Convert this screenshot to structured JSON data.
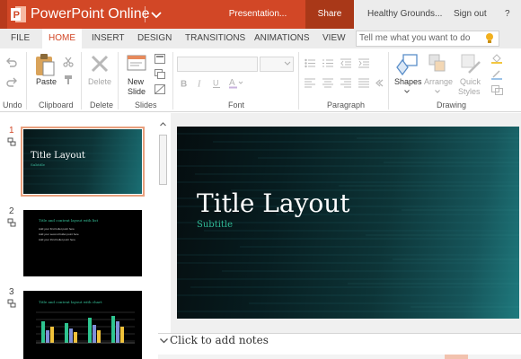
{
  "titlebar": {
    "app_name": "PowerPoint Online",
    "doc_name": "Presentation...",
    "share_label": "Share",
    "user_name": "Healthy Grounds...",
    "signout_label": "Sign out",
    "help_label": "?"
  },
  "tabs": [
    {
      "label": "FILE"
    },
    {
      "label": "HOME"
    },
    {
      "label": "INSERT"
    },
    {
      "label": "DESIGN"
    },
    {
      "label": "TRANSITIONS"
    },
    {
      "label": "ANIMATIONS"
    },
    {
      "label": "VIEW"
    }
  ],
  "active_tab": "HOME",
  "tellme": {
    "placeholder": "Tell me what you want to do"
  },
  "ribbon": {
    "groups": [
      {
        "label": "Undo"
      },
      {
        "label": "Clipboard"
      },
      {
        "label": "Delete"
      },
      {
        "label": "Slides"
      },
      {
        "label": "Font"
      },
      {
        "label": "Paragraph"
      },
      {
        "label": "Drawing"
      }
    ],
    "buttons": {
      "paste": "Paste",
      "delete": "Delete",
      "new_slide_line1": "New",
      "new_slide_line2": "Slide",
      "shapes": "Shapes",
      "arrange": "Arrange",
      "quick_styles_line1": "Quick",
      "quick_styles_line2": "Styles"
    }
  },
  "thumbnails": [
    {
      "number": "1",
      "title": "Title Layout",
      "subtitle": "Subtitle",
      "selected": true
    },
    {
      "number": "2",
      "title": "Title and content layout with list",
      "bullets": [
        "Add your first bullet point here",
        "Add your second bullet point here",
        "Add your third bullet point here"
      ],
      "selected": false
    },
    {
      "number": "3",
      "title": "Title and content layout with chart",
      "selected": false
    }
  ],
  "slide": {
    "title": "Title Layout",
    "subtitle": "Subtitle"
  },
  "notes": {
    "placeholder": "Click to add notes"
  },
  "colors": {
    "brand": "#d24726",
    "share_bg": "#a93818",
    "subtitle_teal": "#2fb894",
    "slide_dark": "#050d0f",
    "slide_teal": "#1f7a7e"
  }
}
